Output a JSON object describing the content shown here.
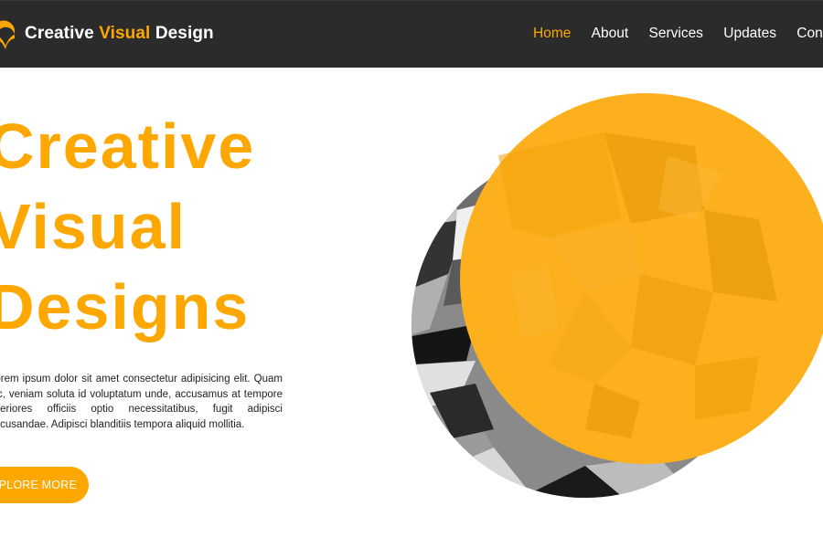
{
  "navbar": {
    "brand_part1": "Creative",
    "brand_accent": "Visual",
    "brand_part2": "Design",
    "links": [
      "Home",
      "About",
      "Services",
      "Updates",
      "Contact"
    ],
    "active_link": "Home"
  },
  "hero": {
    "title_lines": [
      "Creative",
      "Visual",
      "Designs"
    ],
    "paragraph": "Lorem ipsum dolor sit amet consectetur adipisicing elit. Quam hic, veniam soluta id voluptatum unde, accusamus at tempore inferiores officiis optio necessitatibus, fugit adipisci accusandae. Adipisci blanditiis tempora aliquid mollitia.",
    "button_label": "EXPLORE MORE"
  },
  "colors": {
    "accent": "#fda700",
    "navbar_bg": "#2b2b2b",
    "text_dark": "#222222"
  },
  "icons": {
    "logo": "brand-logo-icon"
  }
}
